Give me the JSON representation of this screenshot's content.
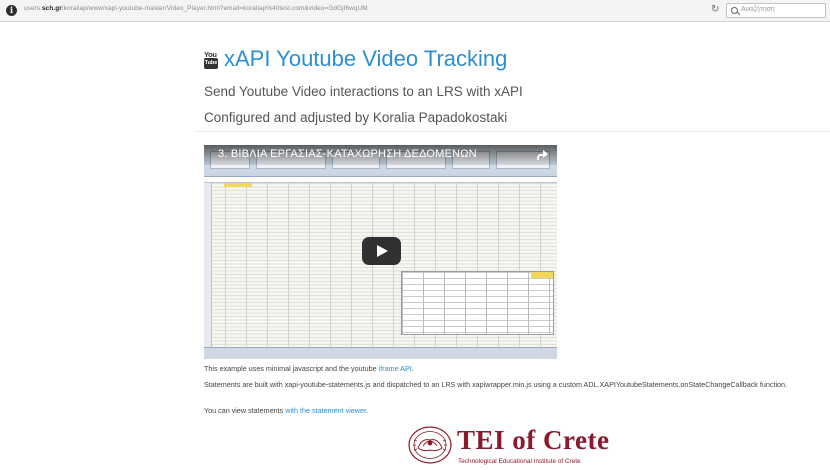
{
  "browser": {
    "url_prefix": "users.",
    "url_domain": "sch.gr",
    "url_path": "/koraliap/www/xapi-youtube-master/Video_Player.html?email=koraliap%40test.com&video=GdGjf6wqUM",
    "search_placeholder": "Αναζήτηση"
  },
  "header": {
    "logo_you": "You",
    "logo_tube": "Tube",
    "title": "xAPI Youtube Video Tracking",
    "subtitle": "Send Youtube Video interactions to an LRS with xAPI",
    "author": "Configured and adjusted by Koralia Papadokostaki"
  },
  "video": {
    "title": "3. ΒΙΒΛΙΑ ΕΡΓΑΣΙΑΣ-ΚΑΤΑΧΩΡΗΣΗ ΔΕΔΟΜΕΝΩΝ"
  },
  "content": {
    "p1_text": "This example uses minimal javascript and the youtube ",
    "p1_link": "iframe API",
    "p1_end": ".",
    "p2_text": "Statements are built with xapi-youtube-statements.js and dispatched to an LRS with xapiwrapper.min.js using a custom ADL.XAPIYoutubeStatements.onStateChangeCallback function.",
    "p3_text": "You can view statements ",
    "p3_link": "with the statement viewer",
    "p3_end": "."
  },
  "footer": {
    "name": "TEI of Crete",
    "subtitle": "Technological Educational Institute of Crete"
  },
  "colors": {
    "title_blue": "#2b8fd0",
    "link_blue": "#2b8fd0",
    "tei_red": "#8b1a2b"
  }
}
